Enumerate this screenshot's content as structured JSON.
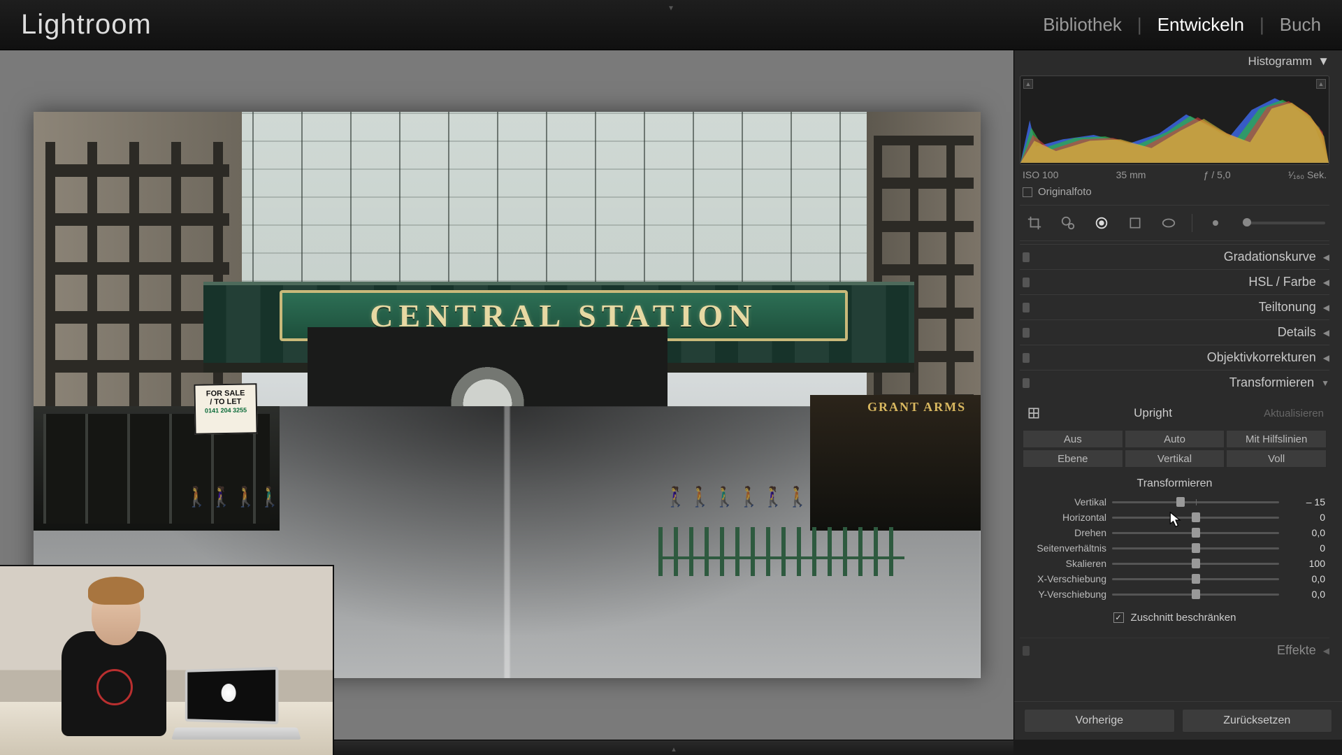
{
  "app": {
    "title": "Lightroom"
  },
  "modules": {
    "library": "Bibliothek",
    "develop": "Entwickeln",
    "book": "Buch",
    "active": "develop"
  },
  "histogram": {
    "title": "Histogramm",
    "iso": "ISO 100",
    "focal": "35 mm",
    "aperture": "ƒ / 5,0",
    "shutter": "¹⁄₁₆₀ Sek.",
    "original_label": "Originalfoto"
  },
  "sections": {
    "tone_curve": "Gradationskurve",
    "hsl": "HSL / Farbe",
    "split_toning": "Teiltonung",
    "detail": "Details",
    "lens": "Objektivkorrekturen",
    "transform": "Transformieren",
    "effects": "Effekte"
  },
  "transform": {
    "upright_label": "Upright",
    "update_label": "Aktualisieren",
    "buttons": {
      "off": "Aus",
      "auto": "Auto",
      "guided": "Mit Hilfslinien",
      "level": "Ebene",
      "vertical": "Vertikal",
      "full": "Voll"
    },
    "group_title": "Transformieren",
    "sliders": {
      "vertical": {
        "label": "Vertikal",
        "value": "– 15",
        "pos": 41
      },
      "horizontal": {
        "label": "Horizontal",
        "value": "0",
        "pos": 50
      },
      "rotate": {
        "label": "Drehen",
        "value": "0,0",
        "pos": 50
      },
      "aspect": {
        "label": "Seitenverhältnis",
        "value": "0",
        "pos": 50
      },
      "scale": {
        "label": "Skalieren",
        "value": "100",
        "pos": 50
      },
      "xoffset": {
        "label": "X-Verschiebung",
        "value": "0,0",
        "pos": 50
      },
      "yoffset": {
        "label": "Y-Verschiebung",
        "value": "0,0",
        "pos": 50
      }
    },
    "constrain_label": "Zuschnitt beschränken",
    "constrain_checked": true
  },
  "footer": {
    "previous": "Vorherige",
    "reset": "Zurücksetzen"
  },
  "photo": {
    "sign_text": "CENTRAL STATION",
    "pub_sign": "GRANT ARMS",
    "forsale_line1": "FOR SALE",
    "forsale_line2": "/ TO LET",
    "forsale_phone": "0141 204 3255"
  }
}
